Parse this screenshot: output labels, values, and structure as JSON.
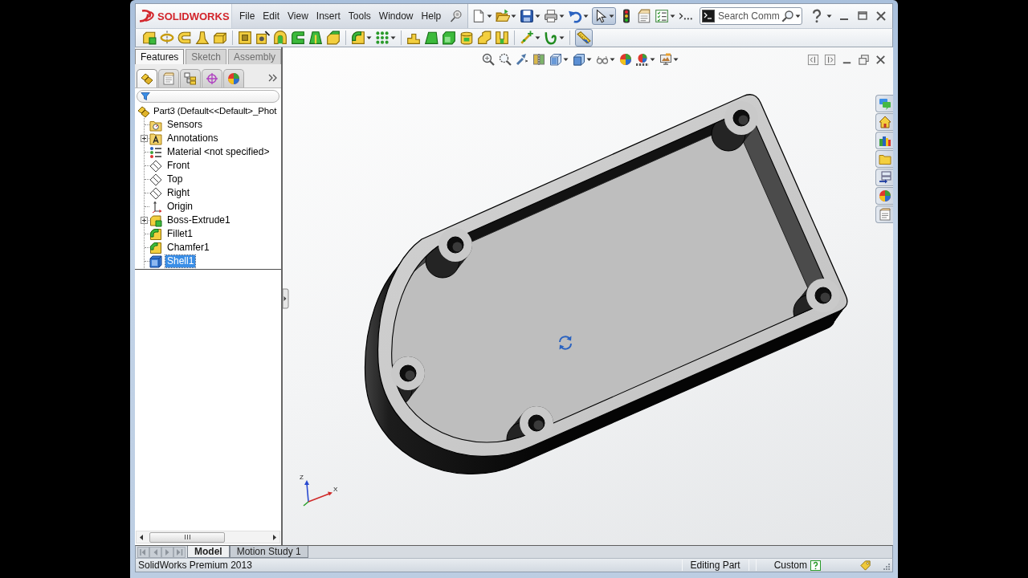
{
  "title_bar": {
    "logo": "SOLIDWORKS",
    "menu": [
      "File",
      "Edit",
      "View",
      "Insert",
      "Tools",
      "Window",
      "Help"
    ],
    "search": {
      "placeholder": "Search Comm"
    }
  },
  "standard_toolbar": [
    {
      "kind": "new",
      "dropdown": true,
      "on": false
    },
    {
      "kind": "open",
      "dropdown": true,
      "on": false
    },
    {
      "kind": "save",
      "dropdown": true,
      "on": false
    },
    {
      "kind": "print",
      "dropdown": true,
      "on": false
    },
    {
      "kind": "undo",
      "dropdown": true,
      "on": false
    },
    {
      "kind": "select",
      "dropdown": true,
      "on": true
    },
    {
      "kind": "rebuild",
      "dropdown": false,
      "on": false
    },
    {
      "kind": "properties",
      "dropdown": false,
      "on": false
    },
    {
      "kind": "options",
      "dropdown": true,
      "on": false
    },
    {
      "kind": "more",
      "dropdown": false,
      "on": false
    }
  ],
  "command_manager": {
    "groups": [
      [
        {
          "kind": "boss",
          "dropdown": false,
          "on": false
        },
        {
          "kind": "revolve",
          "dropdown": false,
          "on": false
        },
        {
          "kind": "sweep",
          "dropdown": false,
          "on": false
        },
        {
          "kind": "loft",
          "dropdown": false,
          "on": false
        },
        {
          "kind": "boundary",
          "dropdown": false,
          "on": false
        }
      ],
      [
        {
          "kind": "cut",
          "dropdown": false,
          "on": false
        },
        {
          "kind": "hole",
          "dropdown": false,
          "on": false
        },
        {
          "kind": "revcut",
          "dropdown": false,
          "on": false
        },
        {
          "kind": "sweptcut",
          "dropdown": false,
          "on": false
        },
        {
          "kind": "loftcut",
          "dropdown": false,
          "on": false
        },
        {
          "kind": "boundcut",
          "dropdown": false,
          "on": false
        }
      ],
      [
        {
          "kind": "fillet",
          "dropdown": true,
          "on": false
        },
        {
          "kind": "pattern",
          "dropdown": true,
          "on": false
        }
      ],
      [
        {
          "kind": "rib",
          "dropdown": false,
          "on": false
        },
        {
          "kind": "draft",
          "dropdown": false,
          "on": false
        },
        {
          "kind": "shell",
          "dropdown": false,
          "on": false
        },
        {
          "kind": "wrap",
          "dropdown": false,
          "on": false
        },
        {
          "kind": "intersect",
          "dropdown": false,
          "on": false
        },
        {
          "kind": "mirror",
          "dropdown": false,
          "on": false
        }
      ],
      [
        {
          "kind": "refgeom",
          "dropdown": true,
          "on": false
        },
        {
          "kind": "curves",
          "dropdown": true,
          "on": false
        }
      ],
      [
        {
          "kind": "instant3d",
          "dropdown": false,
          "on": true
        }
      ]
    ]
  },
  "feature_manager": {
    "tabs": [
      {
        "label": "Features",
        "selected": true
      },
      {
        "label": "Sketch",
        "selected": false
      },
      {
        "label": "Assembly",
        "selected": false
      }
    ],
    "panel_tabs": [
      {
        "kind": "tree",
        "selected": true
      },
      {
        "kind": "properties",
        "selected": false
      },
      {
        "kind": "config",
        "selected": false
      },
      {
        "kind": "dimxpert",
        "selected": false
      },
      {
        "kind": "display",
        "selected": false
      }
    ],
    "tree": {
      "label": "Part3 (Default<<Default>_Phot",
      "kind": "part",
      "selected": false,
      "children": [
        {
          "label": "Sensors",
          "kind": "sensors",
          "selected": false,
          "collapsed": false
        },
        {
          "label": "Annotations",
          "kind": "annotations",
          "selected": false,
          "collapsed": true
        },
        {
          "label": "Material <not specified>",
          "kind": "material",
          "selected": false,
          "collapsed": false
        },
        {
          "label": "Front",
          "kind": "plane",
          "selected": false,
          "collapsed": false
        },
        {
          "label": "Top",
          "kind": "plane",
          "selected": false,
          "collapsed": false
        },
        {
          "label": "Right",
          "kind": "plane",
          "selected": false,
          "collapsed": false
        },
        {
          "label": "Origin",
          "kind": "origin",
          "selected": false,
          "collapsed": false
        },
        {
          "label": "Boss-Extrude1",
          "kind": "extrude",
          "selected": false,
          "collapsed": true
        },
        {
          "label": "Fillet1",
          "kind": "fillet",
          "selected": false,
          "collapsed": false
        },
        {
          "label": "Chamfer1",
          "kind": "chamfer",
          "selected": false,
          "collapsed": false
        },
        {
          "label": "Shell1",
          "kind": "shell",
          "selected": true,
          "collapsed": false
        }
      ]
    }
  },
  "graphics": {
    "heads_up": [
      {
        "kind": "zoomfit",
        "dropdown": false
      },
      {
        "kind": "zoomarea",
        "dropdown": false
      },
      {
        "kind": "prevview",
        "dropdown": false
      },
      {
        "kind": "section",
        "dropdown": false
      },
      {
        "kind": "orientation",
        "dropdown": true
      },
      {
        "kind": "displaystyle",
        "dropdown": true
      },
      {
        "kind": "hideshow",
        "dropdown": true
      },
      {
        "kind": "appearance",
        "dropdown": false
      },
      {
        "kind": "scene",
        "dropdown": true
      },
      {
        "kind": "viewsettings",
        "dropdown": true
      }
    ],
    "task_pane": [
      {
        "kind": "resources"
      },
      {
        "kind": "home"
      },
      {
        "kind": "library"
      },
      {
        "kind": "explorer"
      },
      {
        "kind": "palette"
      },
      {
        "kind": "appearances"
      },
      {
        "kind": "customprops"
      }
    ],
    "triad_labels": [
      "Z",
      "X"
    ]
  },
  "bottom_tabs": [
    {
      "label": "Model",
      "selected": true
    },
    {
      "label": "Motion Study 1",
      "selected": false
    }
  ],
  "status_bar": {
    "product": "SolidWorks Premium 2013",
    "mode": "Editing Part",
    "units": "Custom"
  }
}
